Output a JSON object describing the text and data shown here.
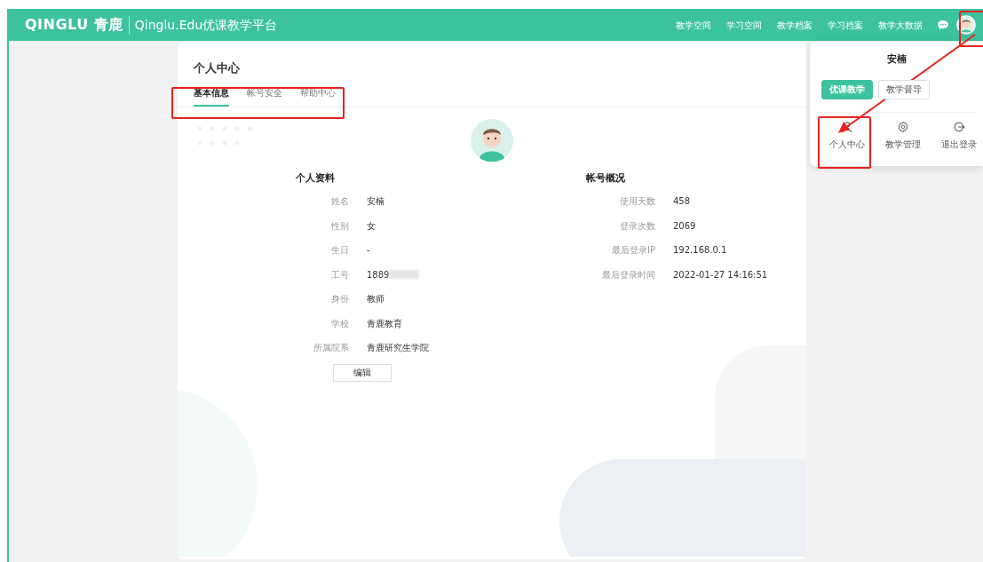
{
  "header": {
    "logo": "QINGLU 青鹿",
    "platform_title": "Qinglu.Edu优课教学平台",
    "nav": [
      "教学空间",
      "学习空间",
      "教学档案",
      "学习档案",
      "教学大数据"
    ]
  },
  "page": {
    "title": "个人中心",
    "tabs": [
      {
        "label": "基本信息",
        "selected": true
      },
      {
        "label": "帐号安全",
        "selected": false
      },
      {
        "label": "帮助中心",
        "selected": false
      }
    ],
    "profile": {
      "title": "个人资料",
      "fields": [
        {
          "label": "姓名",
          "value": "安楠"
        },
        {
          "label": "性别",
          "value": "女"
        },
        {
          "label": "生日",
          "value": "-"
        },
        {
          "label": "工号",
          "value": "1889",
          "redacted": true
        },
        {
          "label": "身份",
          "value": "教师"
        },
        {
          "label": "学校",
          "value": "青鹿教育"
        },
        {
          "label": "所属院系",
          "value": "青鹿研究生学院"
        }
      ]
    },
    "account": {
      "title": "帐号概况",
      "fields": [
        {
          "label": "使用天数",
          "value": "458"
        },
        {
          "label": "登录次数",
          "value": "2069"
        },
        {
          "label": "最后登录IP",
          "value": "192.168.0.1"
        },
        {
          "label": "最后登录时间",
          "value": "2022-01-27 14:16:51"
        }
      ]
    },
    "edit_button": "编辑"
  },
  "user_menu": {
    "user_name": "安楠",
    "roles": [
      {
        "label": "优课教学",
        "selected": true
      },
      {
        "label": "教学督导",
        "selected": false
      }
    ],
    "actions": [
      {
        "label": "个人中心",
        "kind": "person"
      },
      {
        "label": "教学管理",
        "kind": "gear"
      },
      {
        "label": "退出登录",
        "kind": "logout"
      }
    ]
  }
}
